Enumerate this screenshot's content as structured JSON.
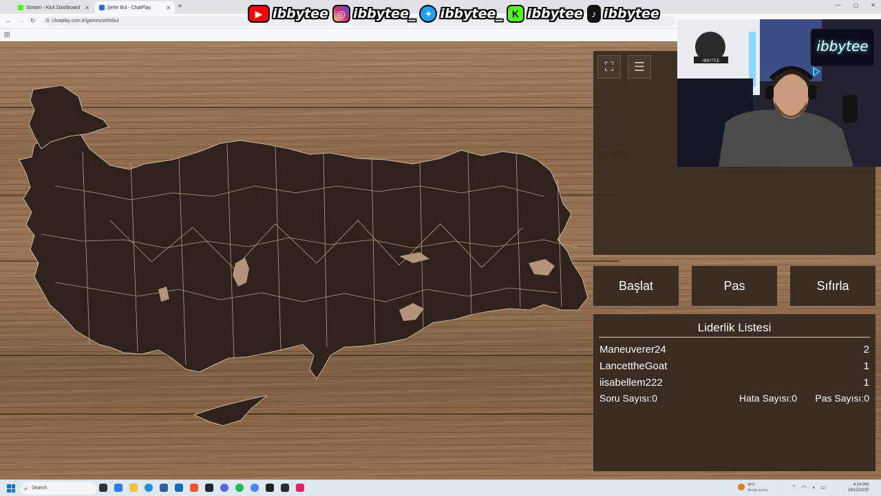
{
  "browser": {
    "tabs": [
      {
        "title": "Stream - Kick Dashboard",
        "active": false,
        "icon": "kick-icon",
        "color": "#53fc18"
      },
      {
        "title": "Şehir Bul - ChatPlay",
        "active": true,
        "icon": "chatplay-icon",
        "color": "#2e6bd6"
      }
    ],
    "new_tab": "+",
    "url": "chatplay.com.tr/games/sehirbul",
    "window_controls": [
      "—",
      "▢",
      "✕"
    ]
  },
  "social_overlay": {
    "items": [
      {
        "platform": "youtube",
        "icon": "youtube-icon",
        "handle": "ibbytee",
        "color": "#ff0000"
      },
      {
        "platform": "instagram",
        "icon": "instagram-icon",
        "handle": "ibbytee_",
        "color": "#d62976"
      },
      {
        "platform": "twitter",
        "icon": "twitter-icon",
        "handle": "ibbytee_",
        "color": "#1da1f2"
      },
      {
        "platform": "kick",
        "icon": "kick-icon",
        "handle": "ibbytee",
        "color": "#53fc18"
      },
      {
        "platform": "tiktok",
        "icon": "tiktok-icon",
        "handle": "ibbytee",
        "color": "#111111"
      }
    ]
  },
  "game": {
    "toolbar": {
      "fullscreen_icon": "fullscreen-icon",
      "list_icon": "document-list-icon"
    },
    "buttons": {
      "start": "Başlat",
      "pass": "Pas",
      "reset": "Sıfırla"
    },
    "leaderboard": {
      "title": "Liderlik Listesi",
      "rows": [
        {
          "name": "Maneuverer24",
          "score": "2"
        },
        {
          "name": "LancettheGoat",
          "score": "1"
        },
        {
          "name": "iisabellem222",
          "score": "1"
        }
      ],
      "stats": {
        "questions": "Soru Sayısı:0",
        "errors": "Hata Sayısı:0",
        "passes": "Pas Sayısı:0"
      }
    }
  },
  "webcam": {
    "neon_sign": "ibbytee",
    "mascot_label": "IBBYTEE"
  },
  "taskbar": {
    "search_placeholder": "Search",
    "weather_temp": "34°C",
    "weather_desc": "Mostly sunny",
    "time": "4:24 PM",
    "date": "18/12/2025"
  }
}
